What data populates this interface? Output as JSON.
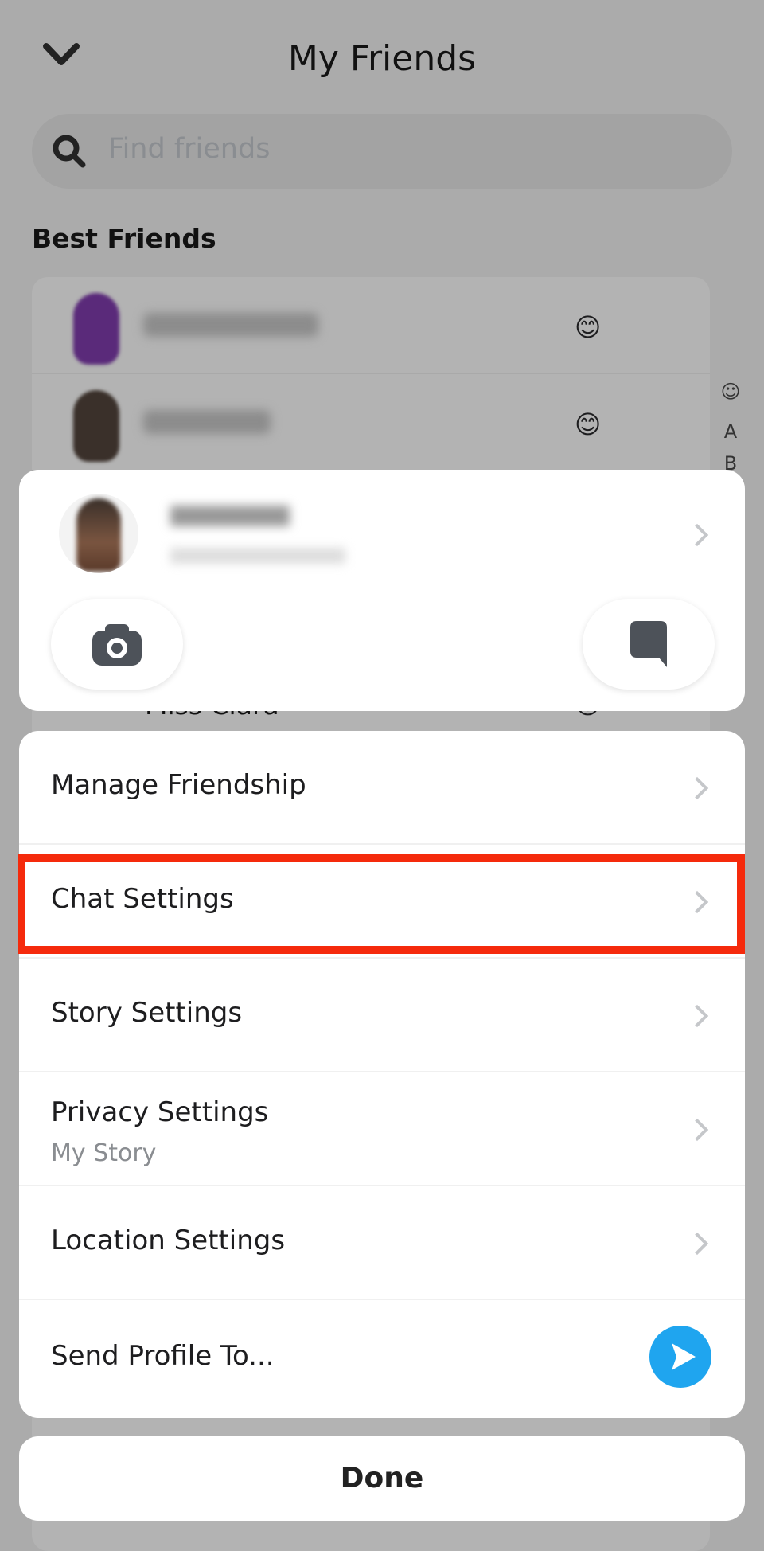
{
  "header": {
    "title": "My Friends",
    "back_icon": "chevron-down-icon"
  },
  "search": {
    "placeholder": "Find friends",
    "icon": "search-icon"
  },
  "section": {
    "title": "Best Friends"
  },
  "friends": [
    {
      "name_blurred": true,
      "emoji": "😊"
    },
    {
      "name_blurred": true,
      "emoji": "😊"
    },
    {
      "name": "Miss Clara",
      "emoji": "😊"
    }
  ],
  "index": {
    "items": [
      "☺",
      "A",
      "B"
    ]
  },
  "profile_sheet": {
    "name_blurred": true,
    "camera_icon": "camera-icon",
    "chat_icon": "chat-bubble-icon"
  },
  "menu": {
    "items": [
      {
        "label": "Manage Friendship"
      },
      {
        "label": "Chat Settings",
        "highlighted": true
      },
      {
        "label": "Story Settings"
      },
      {
        "label": "Privacy Settings",
        "sublabel": "My Story"
      },
      {
        "label": "Location Settings"
      },
      {
        "label": "Send Profile To..."
      }
    ]
  },
  "done_label": "Done",
  "colors": {
    "highlight": "#f52a0c",
    "send": "#1fa5ef"
  }
}
